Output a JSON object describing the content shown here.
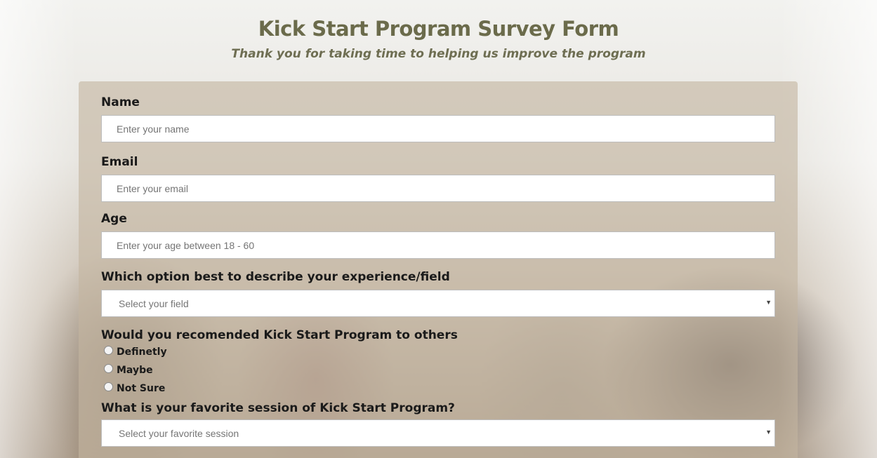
{
  "header": {
    "title": "Kick Start Program Survey Form",
    "subtitle": "Thank you for taking time to helping us improve the program"
  },
  "form": {
    "name": {
      "label": "Name",
      "placeholder": "Enter your name",
      "value": ""
    },
    "email": {
      "label": "Email",
      "placeholder": "Enter your email",
      "value": ""
    },
    "age": {
      "label": "Age",
      "placeholder": "Enter your age between 18 - 60",
      "value": ""
    },
    "field": {
      "label": "Which option best to describe your experience/field",
      "selected": "Select your field"
    },
    "recommend": {
      "label": "Would you recomended Kick Start Program to others",
      "options": [
        "Definetly",
        "Maybe",
        "Not Sure"
      ]
    },
    "session": {
      "label": "What is your favorite session of Kick Start Program?",
      "selected": "Select your favorite session"
    }
  },
  "icons": {
    "select_arrow": "chevron-down-icon"
  },
  "colors": {
    "title": "#6b6b4b",
    "subtitle": "#6e6e52",
    "form_background": "rgba(195,180,160,0.62)"
  }
}
